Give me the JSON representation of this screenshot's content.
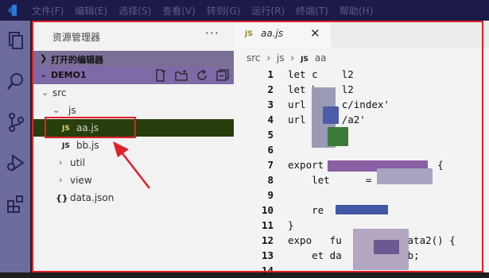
{
  "menu": [
    "文件(F)",
    "编辑(E)",
    "选择(S)",
    "查看(V)",
    "转到(G)",
    "运行(R)",
    "终端(T)",
    "帮助(H)"
  ],
  "activity_icons": [
    "explorer-icon",
    "search-icon",
    "source-control-icon",
    "run-debug-icon",
    "extensions-icon"
  ],
  "sidebar": {
    "title": "资源管理器",
    "more": "···",
    "open_editors": "打开的编辑器",
    "folder": "DEMO1",
    "tree": {
      "src": "src",
      "js": "js",
      "aa": "aa.js",
      "bb": "bb.js",
      "util": "util",
      "view": "view",
      "data": "data.json"
    }
  },
  "editor": {
    "tab": {
      "name": "aa.js",
      "close": "✕"
    },
    "breadcrumb": [
      "src",
      "js",
      "aa"
    ],
    "js_badge": "JS",
    "json_badge": "{}",
    "lines": [
      {
        "n": "1",
        "text": "let c    l2"
      },
      {
        "n": "2",
        "text": "let b    l2"
      },
      {
        "n": "3",
        "text": "url =    c/index'"
      },
      {
        "n": "4",
        "text": "url =    /a2'"
      },
      {
        "n": "5",
        "text": ""
      },
      {
        "n": "6",
        "text": ""
      },
      {
        "n": "7",
        "text": "export           etdata  {"
      },
      {
        "n": "8",
        "text": "    let      = cc "
      },
      {
        "n": "9",
        "text": ""
      },
      {
        "n": "10",
        "text": "    re"
      },
      {
        "n": "11",
        "text": "}"
      },
      {
        "n": "12",
        "text": "expo   fu           ata2() {"
      },
      {
        "n": "13",
        "text": "    et da          bb;"
      },
      {
        "n": "14",
        "text": ""
      }
    ]
  },
  "colors": {
    "accent_red": "#e0202a",
    "menubar": "#1c1a46",
    "activity": "#6d6c9e",
    "active_row": "#283e0c"
  }
}
